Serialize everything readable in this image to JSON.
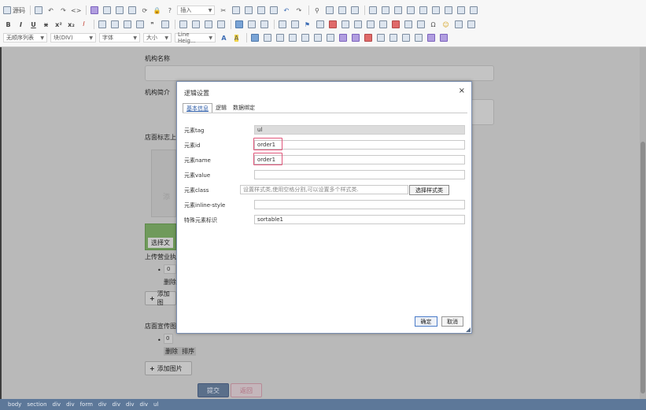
{
  "toolbar": {
    "source_label": "源码",
    "insert_label": "插入",
    "bold": "B",
    "italic": "I",
    "underline": "U",
    "strike": "x",
    "superscript": "x²",
    "subscript": "x₂",
    "list_style": "无顺序列表",
    "block": "块(DIV)",
    "font_family": "字体",
    "font_size": "大小",
    "line_height": "Line Heig..."
  },
  "page": {
    "org_name_label": "机构名称",
    "org_intro_label": "机构简介",
    "store_logo_label": "店面标志上",
    "upload_partial": "添",
    "select_file_partial": "选择文",
    "upload_license_label": "上传营业执",
    "item_bullet_1": "0",
    "delete_label_1": "删除",
    "add_label_1": "添加图",
    "store_promo_label": "店面宣传图",
    "item_bullet_2": "0",
    "delete_sort_label": "删除  排序",
    "add_image_label": "添加图片",
    "submit_label": "提交",
    "back_label": "返回"
  },
  "statusbar": [
    "body",
    "section",
    "div",
    "div",
    "form",
    "div",
    "div",
    "div",
    "div",
    "ul"
  ],
  "dialog": {
    "title": "逻辑设置",
    "close": "×",
    "tabs": [
      {
        "label": "基本信息",
        "active": true
      },
      {
        "label": "逻辑",
        "active": false
      },
      {
        "label": "数据绑定",
        "active": false
      }
    ],
    "fields": {
      "tag": {
        "label": "元素tag",
        "value": "ul"
      },
      "id": {
        "label": "元素id",
        "value": "order1"
      },
      "name": {
        "label": "元素name",
        "value": "order1"
      },
      "value": {
        "label": "元素value",
        "value": ""
      },
      "class": {
        "label": "元素class",
        "placeholder": "设置样式类,使用空格分割,可以设置多个样式类."
      },
      "inline_style": {
        "label": "元素inline-style",
        "value": ""
      },
      "special": {
        "label": "特殊元素标识",
        "value": "sortable1"
      }
    },
    "select_class_button": "选择样式类",
    "ok_button": "确定",
    "cancel_button": "取消"
  },
  "colors": {
    "highlight": "#e0567a",
    "statusbar": "#5d7899",
    "overlay": "#b9b9b9"
  }
}
